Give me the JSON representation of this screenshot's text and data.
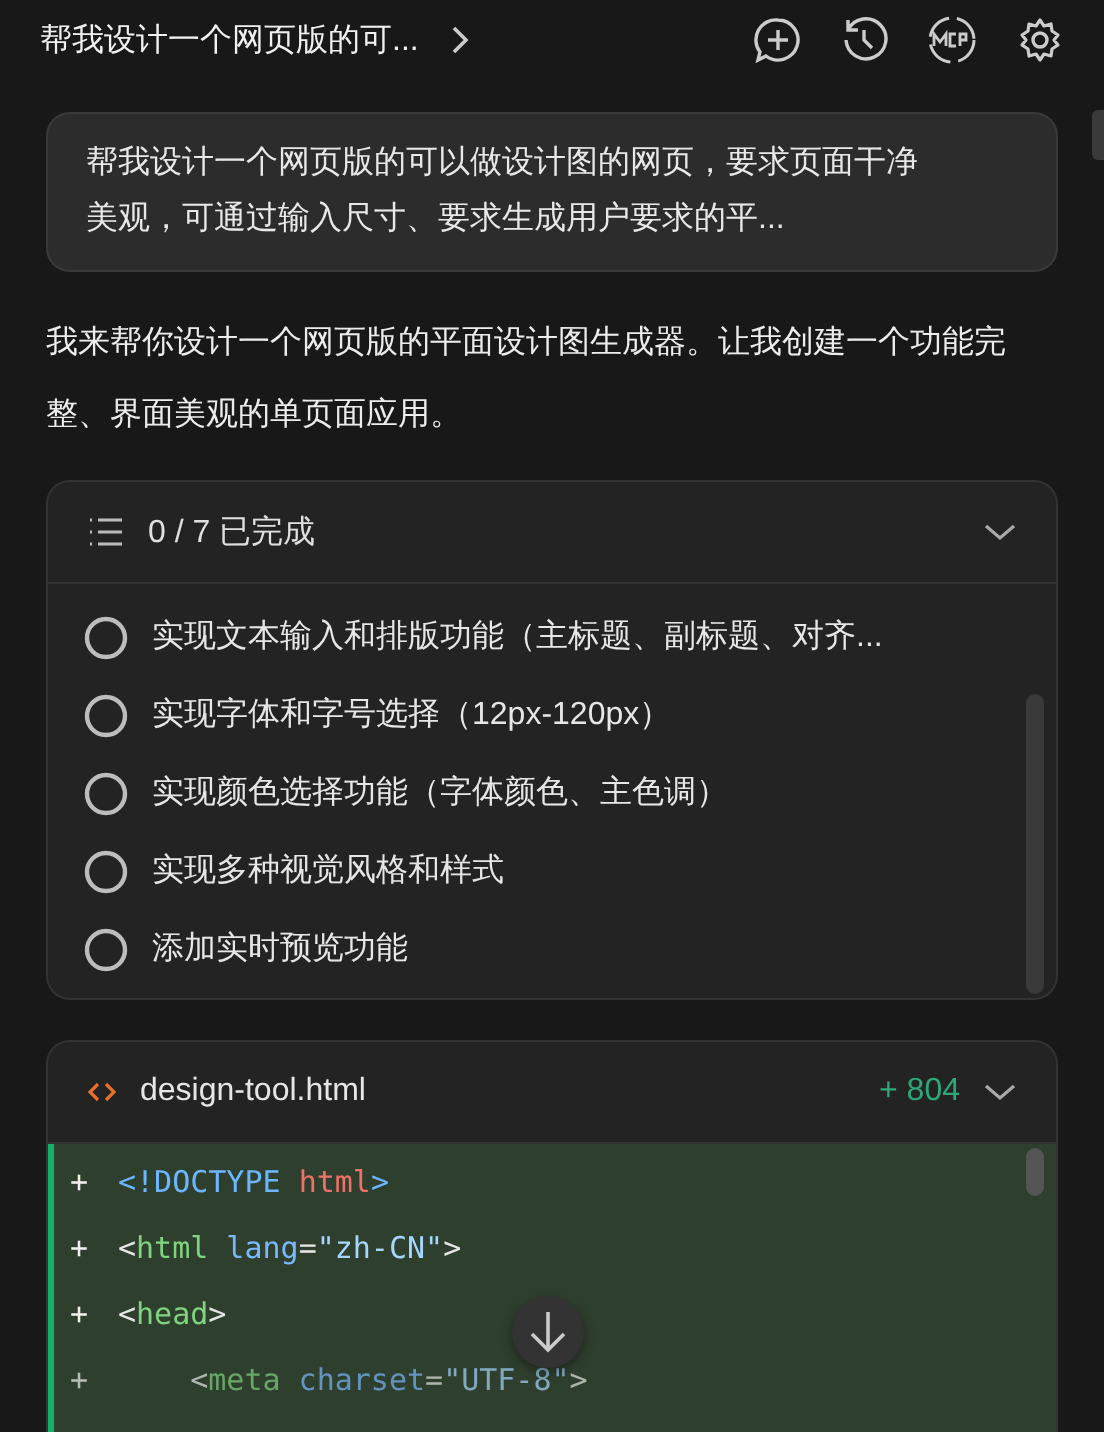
{
  "header": {
    "title": "帮我设计一个网页版的可..."
  },
  "user_message": {
    "text": "帮我设计一个网页版的可以做设计图的网页，要求页面干净美观，可通过输入尺寸、要求生成用户要求的平..."
  },
  "reply": {
    "text": "我来帮你设计一个网页版的平面设计图生成器。让我创建一个功能完整、界面美观的单页面应用。"
  },
  "todo": {
    "summary": "0 / 7 已完成",
    "expanded": true,
    "items": [
      {
        "text": "实现文本输入和排版功能（主标题、副标题、对齐...",
        "checked": false
      },
      {
        "text": "实现字体和字号选择（12px-120px）",
        "checked": false
      },
      {
        "text": "实现颜色选择功能（字体颜色、主色调）",
        "checked": false
      },
      {
        "text": "实现多种视觉风格和样式",
        "checked": false
      },
      {
        "text": "添加实时预览功能",
        "checked": false
      }
    ]
  },
  "file": {
    "name": "design-tool.html",
    "added": "+ 804",
    "lines": [
      {
        "marker": "+",
        "tokens": [
          {
            "kind": "doctype",
            "text": "<!DOCTYPE "
          },
          {
            "kind": "keyword",
            "text": "html"
          },
          {
            "kind": "doctype",
            "text": ">"
          }
        ]
      },
      {
        "marker": "+",
        "tokens": [
          {
            "kind": "punct",
            "text": "<"
          },
          {
            "kind": "tag",
            "text": "html"
          },
          {
            "kind": "attr",
            "text": " lang"
          },
          {
            "kind": "punct",
            "text": "="
          },
          {
            "kind": "string",
            "text": "\"zh-CN\""
          },
          {
            "kind": "punct",
            "text": ">"
          }
        ]
      },
      {
        "marker": "+",
        "tokens": [
          {
            "kind": "punct",
            "text": "<"
          },
          {
            "kind": "tag",
            "text": "head"
          },
          {
            "kind": "punct",
            "text": ">"
          }
        ]
      },
      {
        "marker": "+",
        "tokens": [
          {
            "kind": "punct",
            "text": "    <"
          },
          {
            "kind": "tag",
            "text": "meta"
          },
          {
            "kind": "attr",
            "text": " charset"
          },
          {
            "kind": "punct",
            "text": "="
          },
          {
            "kind": "string",
            "text": "\"UTF-8\""
          },
          {
            "kind": "punct",
            "text": ">"
          }
        ]
      }
    ]
  }
}
